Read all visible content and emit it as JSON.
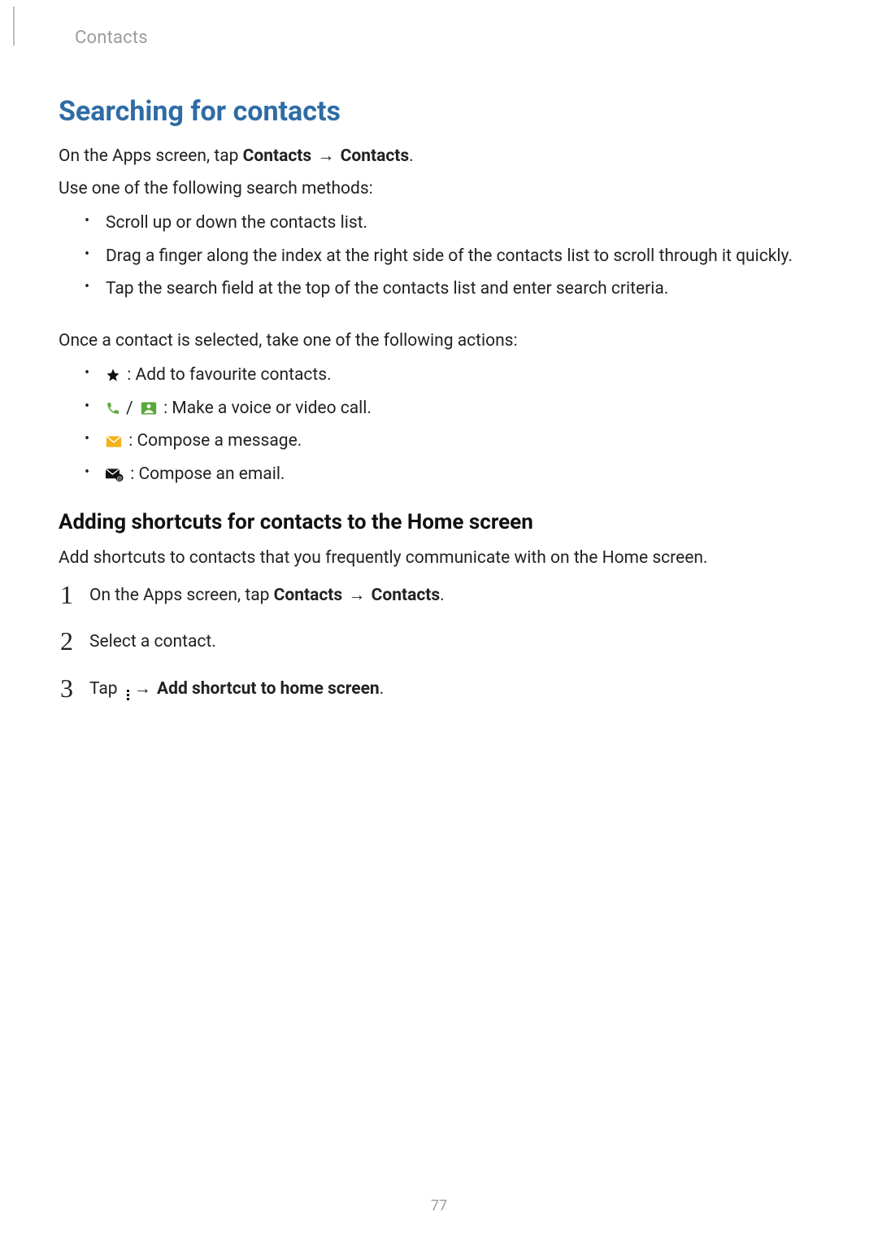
{
  "header": {
    "chapter": "Contacts"
  },
  "title": "Searching for contacts",
  "intro": {
    "pre": "On the Apps screen, tap ",
    "nav1": "Contacts",
    "nav2": "Contacts",
    "post": "."
  },
  "line2": "Use one of the following search methods:",
  "bullets1": [
    "Scroll up or down the contacts list.",
    "Drag a finger along the index at the right side of the contacts list to scroll through it quickly.",
    "Tap the search field at the top of the contacts list and enter search criteria."
  ],
  "line3": "Once a contact is selected, take one of the following actions:",
  "actions": {
    "favourite": " : Add to favourite contacts.",
    "call": " : Make a voice or video call.",
    "message": " : Compose a message.",
    "email": " : Compose an email."
  },
  "subsection": {
    "title": "Adding shortcuts for contacts to the Home screen",
    "intro": "Add shortcuts to contacts that you frequently communicate with on the Home screen."
  },
  "steps": {
    "s1_pre": "On the Apps screen, tap ",
    "s1_nav1": "Contacts",
    "s1_nav2": "Contacts",
    "s1_post": ".",
    "s2": "Select a contact.",
    "s3_pre": "Tap",
    "s3_bold": "Add shortcut to home screen",
    "s3_post": "."
  },
  "arrow": "→",
  "page_number": "77"
}
